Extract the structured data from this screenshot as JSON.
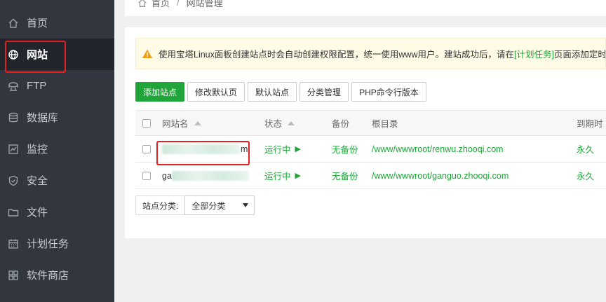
{
  "sidebar": {
    "items": [
      {
        "label": "首页",
        "icon": "home-icon"
      },
      {
        "label": "网站",
        "icon": "globe-icon",
        "active": true
      },
      {
        "label": "FTP",
        "icon": "ftp-icon"
      },
      {
        "label": "数据库",
        "icon": "database-icon"
      },
      {
        "label": "监控",
        "icon": "monitor-icon"
      },
      {
        "label": "安全",
        "icon": "shield-icon"
      },
      {
        "label": "文件",
        "icon": "folder-icon"
      },
      {
        "label": "计划任务",
        "icon": "calendar-icon"
      },
      {
        "label": "软件商店",
        "icon": "grid-icon"
      }
    ]
  },
  "breadcrumb": {
    "home": "首页",
    "separator": "/",
    "current": "网站管理"
  },
  "notice": {
    "text_before": "使用宝塔Linux面板创建站点时会自动创建权限配置，统一使用www用户。建站成功后，请在",
    "link": "[计划任务]",
    "text_after": "页面添加定时备"
  },
  "toolbar": {
    "add_site": "添加站点",
    "edit_default_page": "修改默认页",
    "default_site": "默认站点",
    "category_manage": "分类管理",
    "php_cli_version": "PHP命令行版本"
  },
  "table": {
    "headers": {
      "name": "网站名",
      "status": "状态",
      "backup": "备份",
      "root": "根目录",
      "expire": "到期时"
    },
    "rows": [
      {
        "name_prefix": "",
        "name_suffix": "m",
        "status": "运行中",
        "backup": "无备份",
        "root": "/www/wwwroot/renwu.zhooqi.com",
        "expire": "永久"
      },
      {
        "name_prefix": "ga",
        "name_suffix": "",
        "status": "运行中",
        "backup": "无备份",
        "root": "/www/wwwroot/ganguo.zhooqi.com",
        "expire": "永久"
      }
    ]
  },
  "filter": {
    "label": "站点分类:",
    "selected": "全部分类"
  },
  "colors": {
    "sidebar_bg": "#32363f",
    "accent_green": "#20a53a",
    "highlight_red": "#e02020",
    "notice_bg": "#fffbe6"
  }
}
